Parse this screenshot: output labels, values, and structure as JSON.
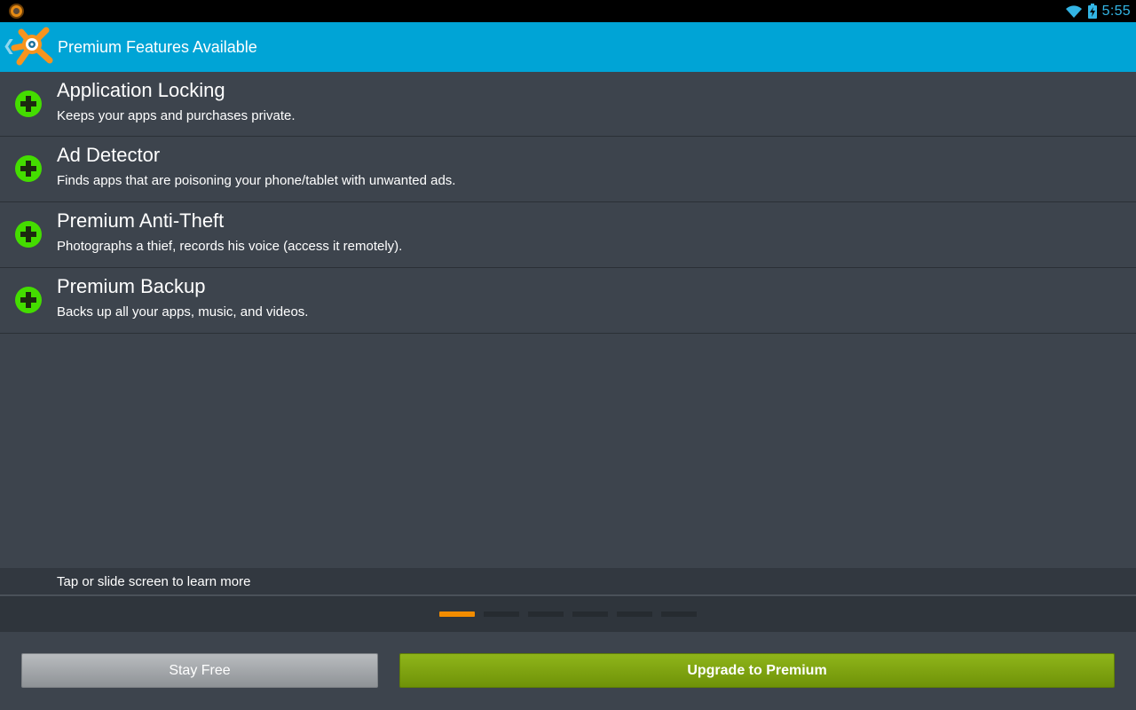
{
  "status_bar": {
    "time": "5:55",
    "icons": [
      "avast-notification-icon",
      "wifi-icon",
      "battery-charging-icon"
    ],
    "clock_color": "#33b5e5"
  },
  "action_bar": {
    "title": "Premium Features Available",
    "up_icon": "chevron-left-icon",
    "logo": "avast-logo",
    "background": "#00a4d6"
  },
  "features": [
    {
      "title": "Application Locking",
      "description": "Keeps your apps and purchases private.",
      "icon": "plus-icon"
    },
    {
      "title": "Ad Detector",
      "description": "Finds apps that are poisoning your phone/tablet with unwanted ads.",
      "icon": "plus-icon"
    },
    {
      "title": "Premium Anti-Theft",
      "description": "Photographs a thief, records his voice (access it remotely).",
      "icon": "plus-icon"
    },
    {
      "title": "Premium Backup",
      "description": "Backs up all your apps, music, and videos.",
      "icon": "plus-icon"
    }
  ],
  "hint": "Tap or slide screen to learn more",
  "pager": {
    "page_count": 6,
    "current_page": 1
  },
  "buttons": {
    "stay_free": "Stay Free",
    "upgrade": "Upgrade to Premium"
  },
  "colors": {
    "accent": "#00a4d6",
    "plus_green": "#44dd00",
    "indicator_active": "#f28c00",
    "upgrade_green": "#7fa312"
  }
}
